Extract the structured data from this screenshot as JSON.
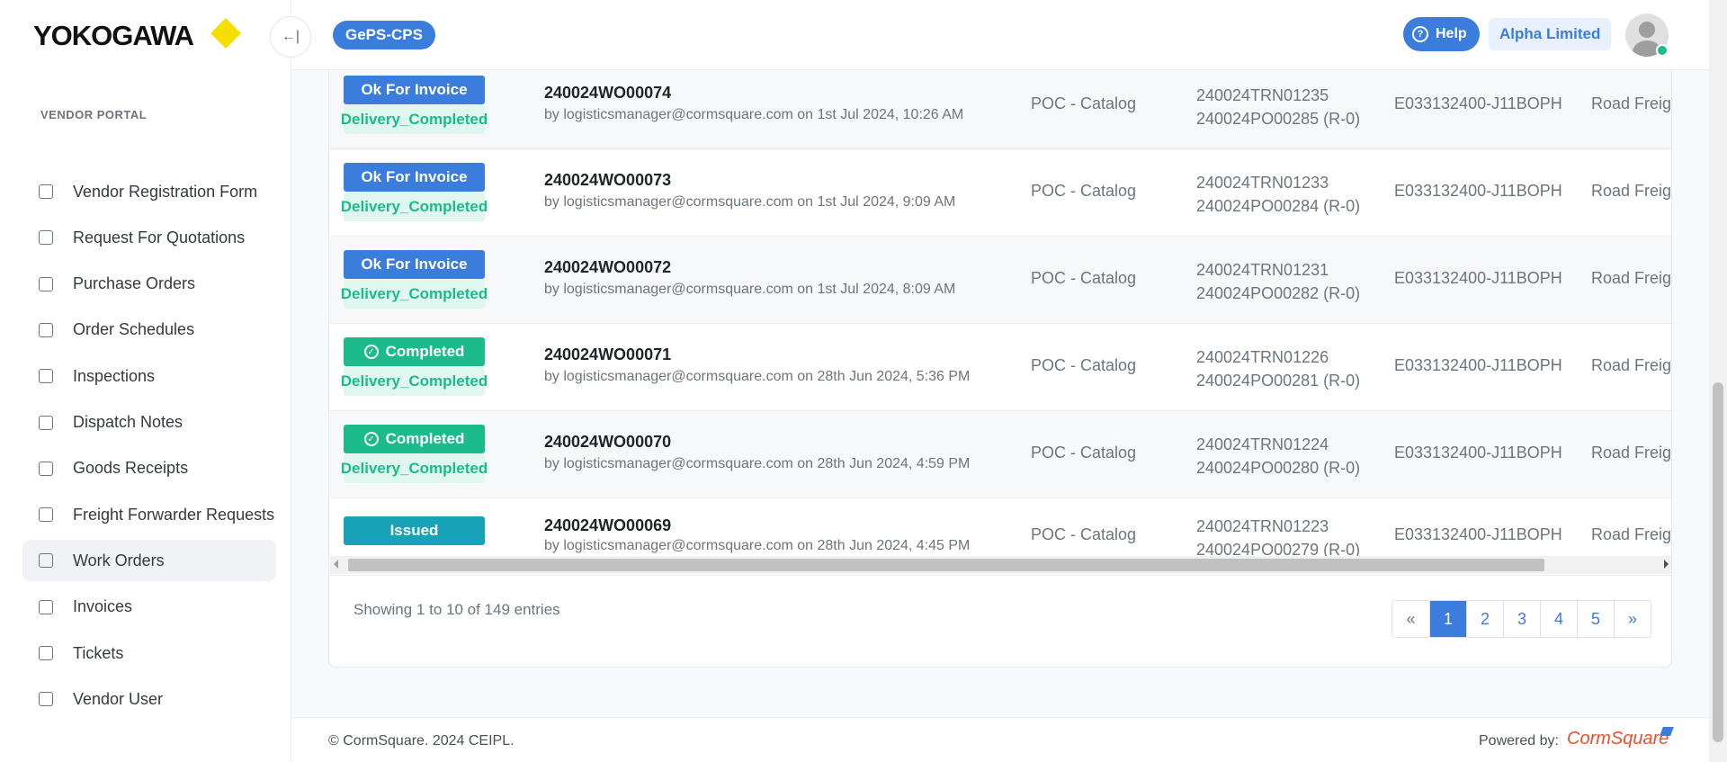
{
  "header": {
    "logo_text": "YOKOGAWA",
    "collapse_icon": "←|",
    "brand": "GePS-CPS",
    "help_label": "Help",
    "company": "Alpha Limited"
  },
  "sidebar": {
    "heading": "VENDOR PORTAL",
    "items": [
      {
        "label": "Vendor Registration Form",
        "icon": "users-icon"
      },
      {
        "label": "Request For Quotations",
        "icon": "file-icon"
      },
      {
        "label": "Purchase Orders",
        "icon": "chart-file-icon"
      },
      {
        "label": "Order Schedules",
        "icon": "calendar-icon"
      },
      {
        "label": "Inspections",
        "icon": "check-file-icon"
      },
      {
        "label": "Dispatch Notes",
        "icon": "note-icon"
      },
      {
        "label": "Goods Receipts",
        "icon": "receipt-icon"
      },
      {
        "label": "Freight Forwarder Requests",
        "icon": "note-icon"
      },
      {
        "label": "Work Orders",
        "icon": "note-icon",
        "active": true
      },
      {
        "label": "Invoices",
        "icon": "invoice-icon"
      },
      {
        "label": "Tickets",
        "icon": "ticket-icon"
      },
      {
        "label": "Vendor User",
        "icon": "user-file-icon"
      }
    ]
  },
  "rows": [
    {
      "status": "Ok For Invoice",
      "status_color": "blue",
      "sub_status": "Delivery_Completed",
      "wo": "240024WO00074",
      "by": "by logisticsmanager@cormsquare.com on 1st Jul 2024, 10:26 AM",
      "type": "POC - Catalog",
      "trn": "240024TRN01235",
      "po": "240024PO00285 (R-0)",
      "code": "E033132400-J11BOPH",
      "mode": "Road Freight"
    },
    {
      "status": "Ok For Invoice",
      "status_color": "blue",
      "sub_status": "Delivery_Completed",
      "wo": "240024WO00073",
      "by": "by logisticsmanager@cormsquare.com on 1st Jul 2024, 9:09 AM",
      "type": "POC - Catalog",
      "trn": "240024TRN01233",
      "po": "240024PO00284 (R-0)",
      "code": "E033132400-J11BOPH",
      "mode": "Road Freight"
    },
    {
      "status": "Ok For Invoice",
      "status_color": "blue",
      "sub_status": "Delivery_Completed",
      "wo": "240024WO00072",
      "by": "by logisticsmanager@cormsquare.com on 1st Jul 2024, 8:09 AM",
      "type": "POC - Catalog",
      "trn": "240024TRN01231",
      "po": "240024PO00282 (R-0)",
      "code": "E033132400-J11BOPH",
      "mode": "Road Freight"
    },
    {
      "status": "Completed",
      "status_color": "green",
      "sub_status": "Delivery_Completed",
      "wo": "240024WO00071",
      "by": "by logisticsmanager@cormsquare.com on 28th Jun 2024, 5:36 PM",
      "type": "POC - Catalog",
      "trn": "240024TRN01226",
      "po": "240024PO00281 (R-0)",
      "code": "E033132400-J11BOPH",
      "mode": "Road Freight"
    },
    {
      "status": "Completed",
      "status_color": "green",
      "sub_status": "Delivery_Completed",
      "wo": "240024WO00070",
      "by": "by logisticsmanager@cormsquare.com on 28th Jun 2024, 4:59 PM",
      "type": "POC - Catalog",
      "trn": "240024TRN01224",
      "po": "240024PO00280 (R-0)",
      "code": "E033132400-J11BOPH",
      "mode": "Road Freight"
    },
    {
      "status": "Issued",
      "status_color": "teal",
      "sub_status": "",
      "wo": "240024WO00069",
      "by": "by logisticsmanager@cormsquare.com on 28th Jun 2024, 4:45 PM",
      "type": "POC - Catalog",
      "trn": "240024TRN01223",
      "po": "240024PO00279 (R-0)",
      "code": "E033132400-J11BOPH",
      "mode": "Road Freight"
    }
  ],
  "pagination": {
    "showing": "Showing 1 to 10 of 149 entries",
    "prev": "«",
    "pages": [
      "1",
      "2",
      "3",
      "4",
      "5"
    ],
    "current": "1",
    "next": "»"
  },
  "footer": {
    "copyright": "© CormSquare. 2024 CEIPL.",
    "powered_by": "Powered by:",
    "powered_logo": "CormSquare"
  }
}
